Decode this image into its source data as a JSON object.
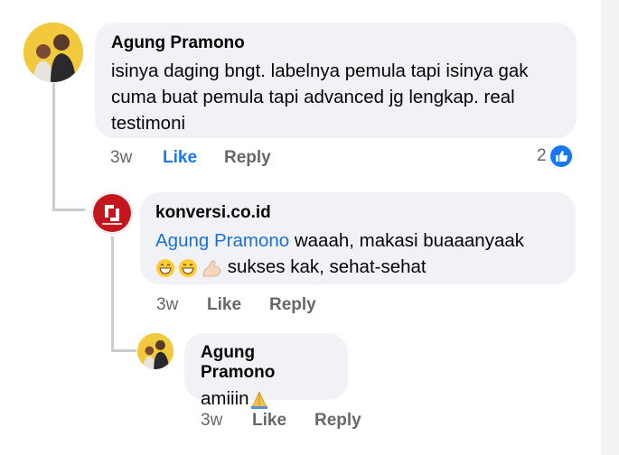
{
  "comments": [
    {
      "author": "Agung Pramono",
      "text": "isinya daging bngt. labelnya pemula tapi isinya gak cuma buat pemula tapi advanced jg lengkap. real testimoni",
      "time": "3w",
      "like_label": "Like",
      "reply_label": "Reply",
      "reaction_count": "2"
    },
    {
      "author": "konversi.co.id",
      "mention": "Agung Pramono",
      "text_after_mention": " waaah, makasi buaaanyaak",
      "text_line2": "sukses kak, sehat-sehat",
      "time": "3w",
      "like_label": "Like",
      "reply_label": "Reply"
    },
    {
      "author": "Agung Pramono",
      "text": "amiiin",
      "time": "3w",
      "like_label": "Like",
      "reply_label": "Reply"
    }
  ],
  "icons": [
    "avatar-photo",
    "konversi-logo",
    "thumbs-up-icon",
    "grinning-emoji-icon",
    "flexed-biceps-emoji-icon",
    "folded-hands-emoji-icon"
  ],
  "colors": {
    "bubble": "#f0f2f5",
    "like_active": "#1877f2",
    "mention": "#1b6fd8",
    "meta": "#65676b",
    "brand_red": "#c4161c"
  }
}
